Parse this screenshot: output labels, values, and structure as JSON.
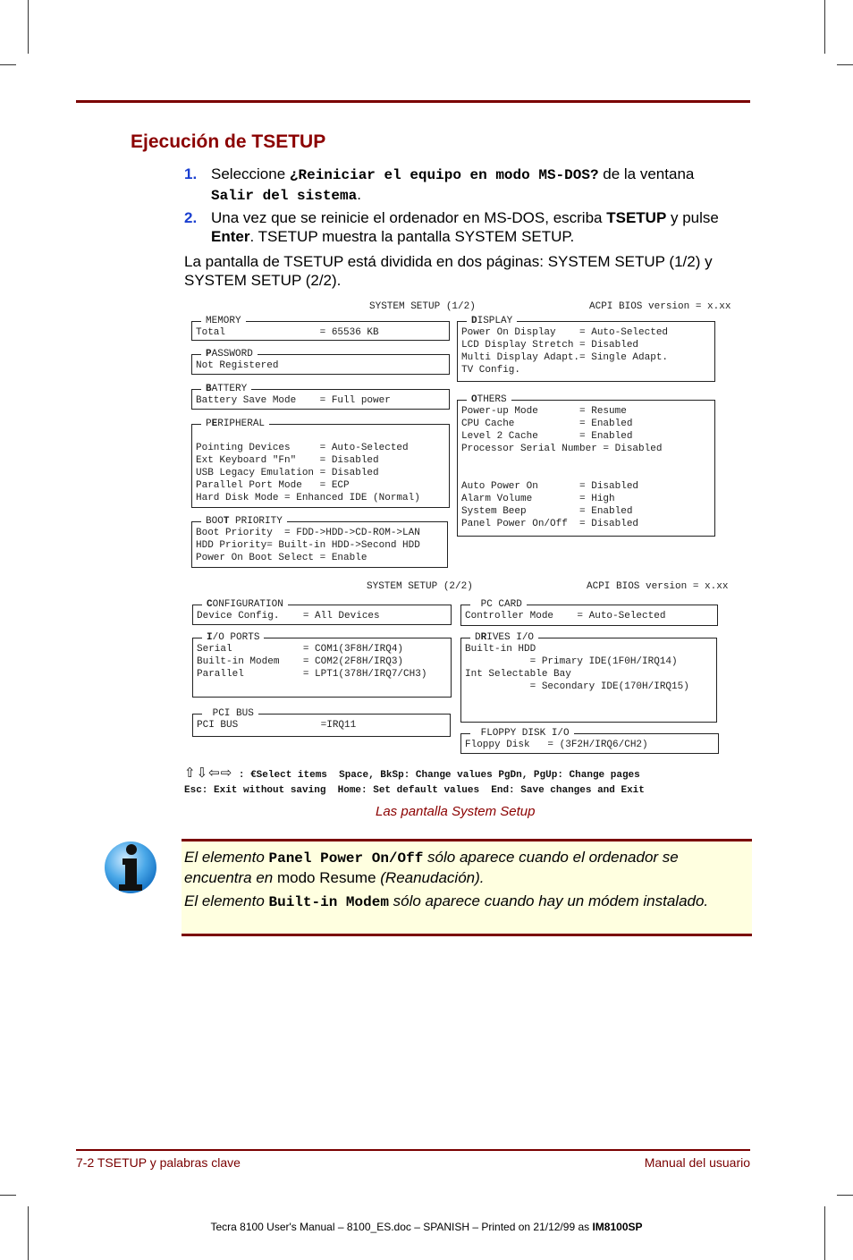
{
  "section_title": "Ejecución de TSETUP",
  "steps": [
    {
      "number": "1.",
      "pre": "Seleccione ",
      "code1": "¿Reiniciar el equipo en modo MS-DOS?",
      "mid": " de la ventana ",
      "code2": "Salir del sistema",
      "post": "."
    },
    {
      "number": "2.",
      "pre": "Una vez que se reinicie el ordenador en MS-DOS, escriba ",
      "bold1": "TSETUP",
      "mid": " y pulse ",
      "bold2": "Enter",
      "post": ". TSETUP muestra la pantalla SYSTEM SETUP."
    }
  ],
  "paragraph": "La pantalla de TSETUP está dividida en dos páginas: SYSTEM SETUP (1/2) y SYSTEM SETUP (2/2).",
  "screen1": {
    "header": "SYSTEM SETUP (1/2)",
    "bios": "ACPI BIOS version = x.xx",
    "memory": {
      "hot": "",
      "legend": "MEMORY",
      "lines": "Total                = 65536 KB"
    },
    "password": {
      "hot": "P",
      "legend": "ASSWORD",
      "lines": "Not Registered"
    },
    "battery": {
      "hot": "B",
      "legend": "ATTERY",
      "lines": "Battery Save Mode    = Full power"
    },
    "peripheral": {
      "pre": "P",
      "hot": "E",
      "legend": "RIPHERAL",
      "lines": "\nPointing Devices     = Auto-Selected\nExt Keyboard \"Fn\"    = Disabled\nUSB Legacy Emulation = Disabled\nParallel Port Mode   = ECP\nHard Disk Mode = Enhanced IDE (Normal)"
    },
    "boot": {
      "pre": "BOO",
      "hot": "T",
      "legend": " PRIORITY",
      "lines": "Boot Priority  = FDD->HDD->CD-ROM->LAN\nHDD Priority= Built-in HDD->Second HDD\nPower On Boot Select = Enable"
    },
    "display": {
      "hot": "D",
      "legend": "ISPLAY",
      "lines": "Power On Display    = Auto-Selected\nLCD Display Stretch = Disabled\nMulti Display Adapt.= Single Adapt.\nTV Config."
    },
    "others": {
      "hot": "O",
      "legend": "THERS",
      "lines": "Power-up Mode       = Resume\nCPU Cache           = Enabled\nLevel 2 Cache       = Enabled\nProcessor Serial Number = Disabled\n\n\nAuto Power On       = Disabled\nAlarm Volume        = High\nSystem Beep         = Enabled\nPanel Power On/Off  = Disabled"
    }
  },
  "screen2": {
    "header": "SYSTEM SETUP (2/2)",
    "bios": "ACPI BIOS version = x.xx",
    "configuration": {
      "hot": "C",
      "legend": "ONFIGURATION",
      "lines": "Device Config.    = All Devices"
    },
    "io_ports": {
      "hot": "I",
      "legend": "/O PORTS",
      "lines": "Serial            = COM1(3F8H/IRQ4)\nBuilt-in Modem    = COM2(2F8H/IRQ3)\nParallel          = LPT1(378H/IRQ7/CH3)"
    },
    "pci_bus": {
      "hot": "",
      "legend": " PCI BUS",
      "lines": "PCI BUS              =IRQ11"
    },
    "pc_card": {
      "hot": "",
      "legend": " PC CARD",
      "lines": "Controller Mode    = Auto-Selected"
    },
    "drives": {
      "pre": "D",
      "hot": "R",
      "legend": "IVES I/O",
      "lines": "Built-in HDD\n           = Primary IDE(1F0H/IRQ14)\nInt Selectable Bay\n           = Secondary IDE(170H/IRQ15)"
    },
    "floppy": {
      "hot": "",
      "legend": " FLOPPY DISK I/O",
      "lines": "Floppy Disk   = (3F2H/IRQ6/CH2)"
    }
  },
  "keys": {
    "arrows": "⇧⇩⇦⇨",
    "line1": " : €Select items  Space, BkSp: Change values PgDn, PgUp: Change pages",
    "line2": "Esc: Exit without saving  Home: Set default values  End: Save changes and Exit"
  },
  "caption": "Las pantalla System Setup",
  "note": {
    "p1_a": "El elemento ",
    "p1_code": "Panel Power On/Off",
    "p1_b": " sólo aparece cuando el ordenador se encuentra en ",
    "p1_up": "modo Resume",
    "p1_c": " (Reanudación).",
    "p2_a": "El elemento ",
    "p2_code": "Built-in Modem",
    "p2_b": " sólo aparece cuando hay un módem instalado."
  },
  "footer": {
    "left": "7-2  TSETUP y palabras clave",
    "right": "Manual del usuario",
    "print_pre": "Tecra 8100 User's Manual  – 8100_ES.doc – SPANISH – Printed on 21/12/99 as ",
    "print_bold": "IM8100SP"
  },
  "colors": {
    "accent": "#7a0000",
    "step_number": "#1a3fd0",
    "note_bg": "#ffffe0"
  }
}
